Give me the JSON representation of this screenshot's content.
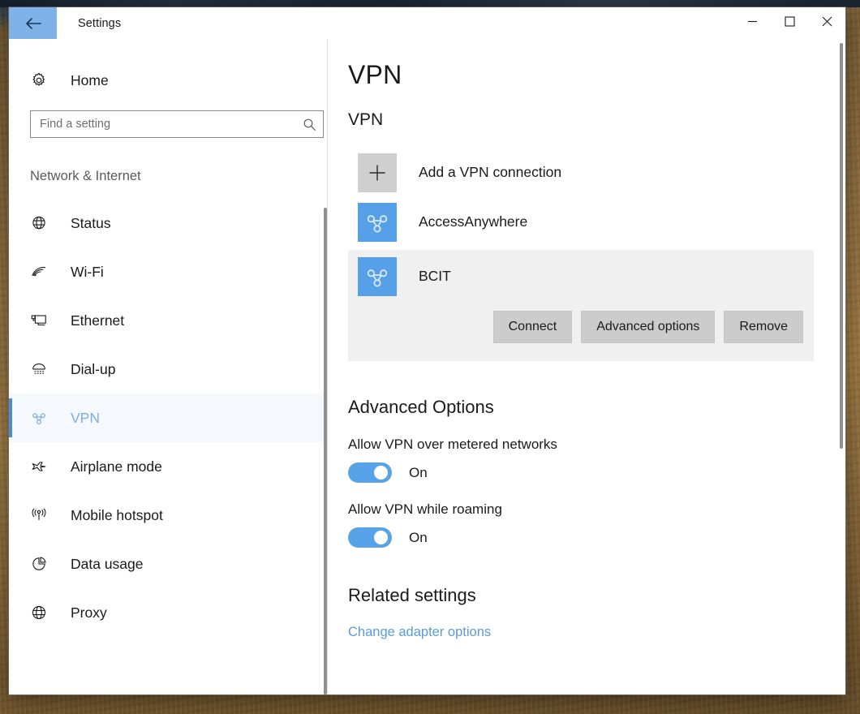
{
  "window": {
    "title": "Settings",
    "back_icon": "back-arrow-icon",
    "controls": {
      "minimize": "minimize-icon",
      "maximize": "maximize-icon",
      "close": "close-icon"
    }
  },
  "sidebar": {
    "home_label": "Home",
    "home_icon": "gear-icon",
    "search": {
      "placeholder": "Find a setting",
      "value": "",
      "icon": "search-icon"
    },
    "section_title": "Network & Internet",
    "items": [
      {
        "label": "Status",
        "icon": "globe-icon",
        "selected": false
      },
      {
        "label": "Wi-Fi",
        "icon": "wifi-icon",
        "selected": false
      },
      {
        "label": "Ethernet",
        "icon": "ethernet-icon",
        "selected": false
      },
      {
        "label": "Dial-up",
        "icon": "dialup-icon",
        "selected": false
      },
      {
        "label": "VPN",
        "icon": "vpn-icon",
        "selected": true
      },
      {
        "label": "Airplane mode",
        "icon": "airplane-icon",
        "selected": false
      },
      {
        "label": "Mobile hotspot",
        "icon": "hotspot-icon",
        "selected": false
      },
      {
        "label": "Data usage",
        "icon": "pie-chart-icon",
        "selected": false
      },
      {
        "label": "Proxy",
        "icon": "globe-icon",
        "selected": false
      }
    ]
  },
  "main": {
    "page_title": "VPN",
    "vpn_section_heading": "VPN",
    "add_connection": {
      "label": "Add a VPN connection",
      "icon": "plus-icon"
    },
    "connections": [
      {
        "name": "AccessAnywhere",
        "icon": "vpn-icon",
        "selected": false
      },
      {
        "name": "BCIT",
        "icon": "vpn-icon",
        "selected": true
      }
    ],
    "selected_connection_actions": [
      {
        "label": "Connect",
        "name": "connect-button"
      },
      {
        "label": "Advanced options",
        "name": "advanced-options-button"
      },
      {
        "label": "Remove",
        "name": "remove-button"
      }
    ],
    "advanced_options": {
      "heading": "Advanced Options",
      "settings": [
        {
          "label": "Allow VPN over metered networks",
          "state": "On"
        },
        {
          "label": "Allow VPN while roaming",
          "state": "On"
        }
      ]
    },
    "related_settings": {
      "heading": "Related settings",
      "links": [
        {
          "label": "Change adapter options"
        }
      ]
    }
  },
  "colors": {
    "accent": "#55a0e8",
    "selected_nav": "#7aaee0",
    "toggle_on": "#57a2e8",
    "panel_bg": "#f0f0f0",
    "button_bg": "#cccccc",
    "link": "#5b9bd5"
  }
}
